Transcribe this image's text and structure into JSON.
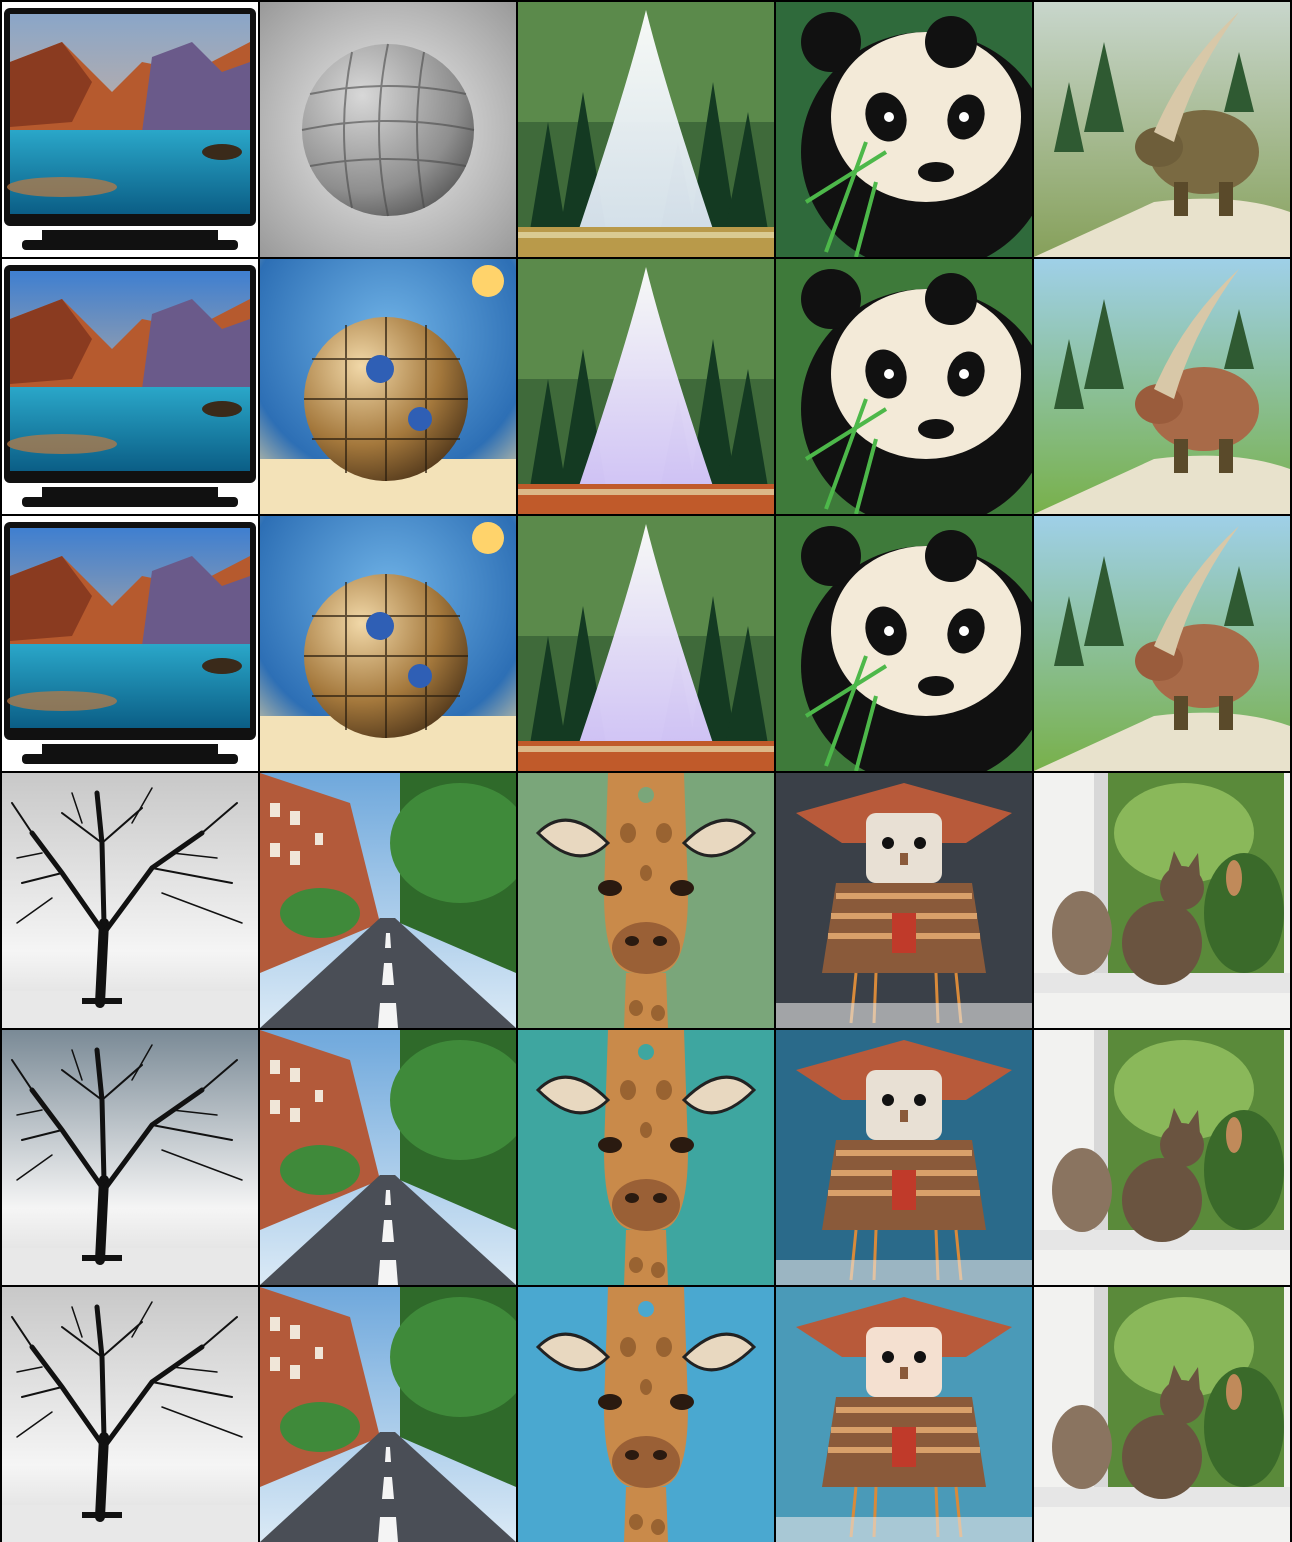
{
  "grid": {
    "rows": 6,
    "columns": 5,
    "background": "#000000",
    "tiles": [
      {
        "subject": "tv",
        "style": "photo"
      },
      {
        "subject": "sphere",
        "style": "photo"
      },
      {
        "subject": "geyser",
        "style": "photo"
      },
      {
        "subject": "panda",
        "style": "photo"
      },
      {
        "subject": "rhino",
        "style": "photo"
      },
      {
        "subject": "tv",
        "style": "photo"
      },
      {
        "subject": "sphere",
        "style": "photo"
      },
      {
        "subject": "geyser",
        "style": "photo"
      },
      {
        "subject": "panda",
        "style": "photo"
      },
      {
        "subject": "rhino",
        "style": "photo"
      },
      {
        "subject": "tv",
        "style": "illustration"
      },
      {
        "subject": "sphere",
        "style": "illustration"
      },
      {
        "subject": "geyser",
        "style": "illustration"
      },
      {
        "subject": "panda",
        "style": "illustration"
      },
      {
        "subject": "rhino",
        "style": "illustration"
      },
      {
        "subject": "tree",
        "style": "photo"
      },
      {
        "subject": "street",
        "style": "photo"
      },
      {
        "subject": "giraffe",
        "style": "photo"
      },
      {
        "subject": "doll",
        "style": "photo"
      },
      {
        "subject": "cat",
        "style": "photo"
      },
      {
        "subject": "tree",
        "style": "photo"
      },
      {
        "subject": "street",
        "style": "photo"
      },
      {
        "subject": "giraffe",
        "style": "photo"
      },
      {
        "subject": "doll",
        "style": "photo"
      },
      {
        "subject": "cat",
        "style": "photo"
      },
      {
        "subject": "tree",
        "style": "illustration"
      },
      {
        "subject": "street",
        "style": "illustration"
      },
      {
        "subject": "giraffe",
        "style": "illustration"
      },
      {
        "subject": "doll",
        "style": "illustration"
      },
      {
        "subject": "cat",
        "style": "illustration"
      }
    ]
  }
}
